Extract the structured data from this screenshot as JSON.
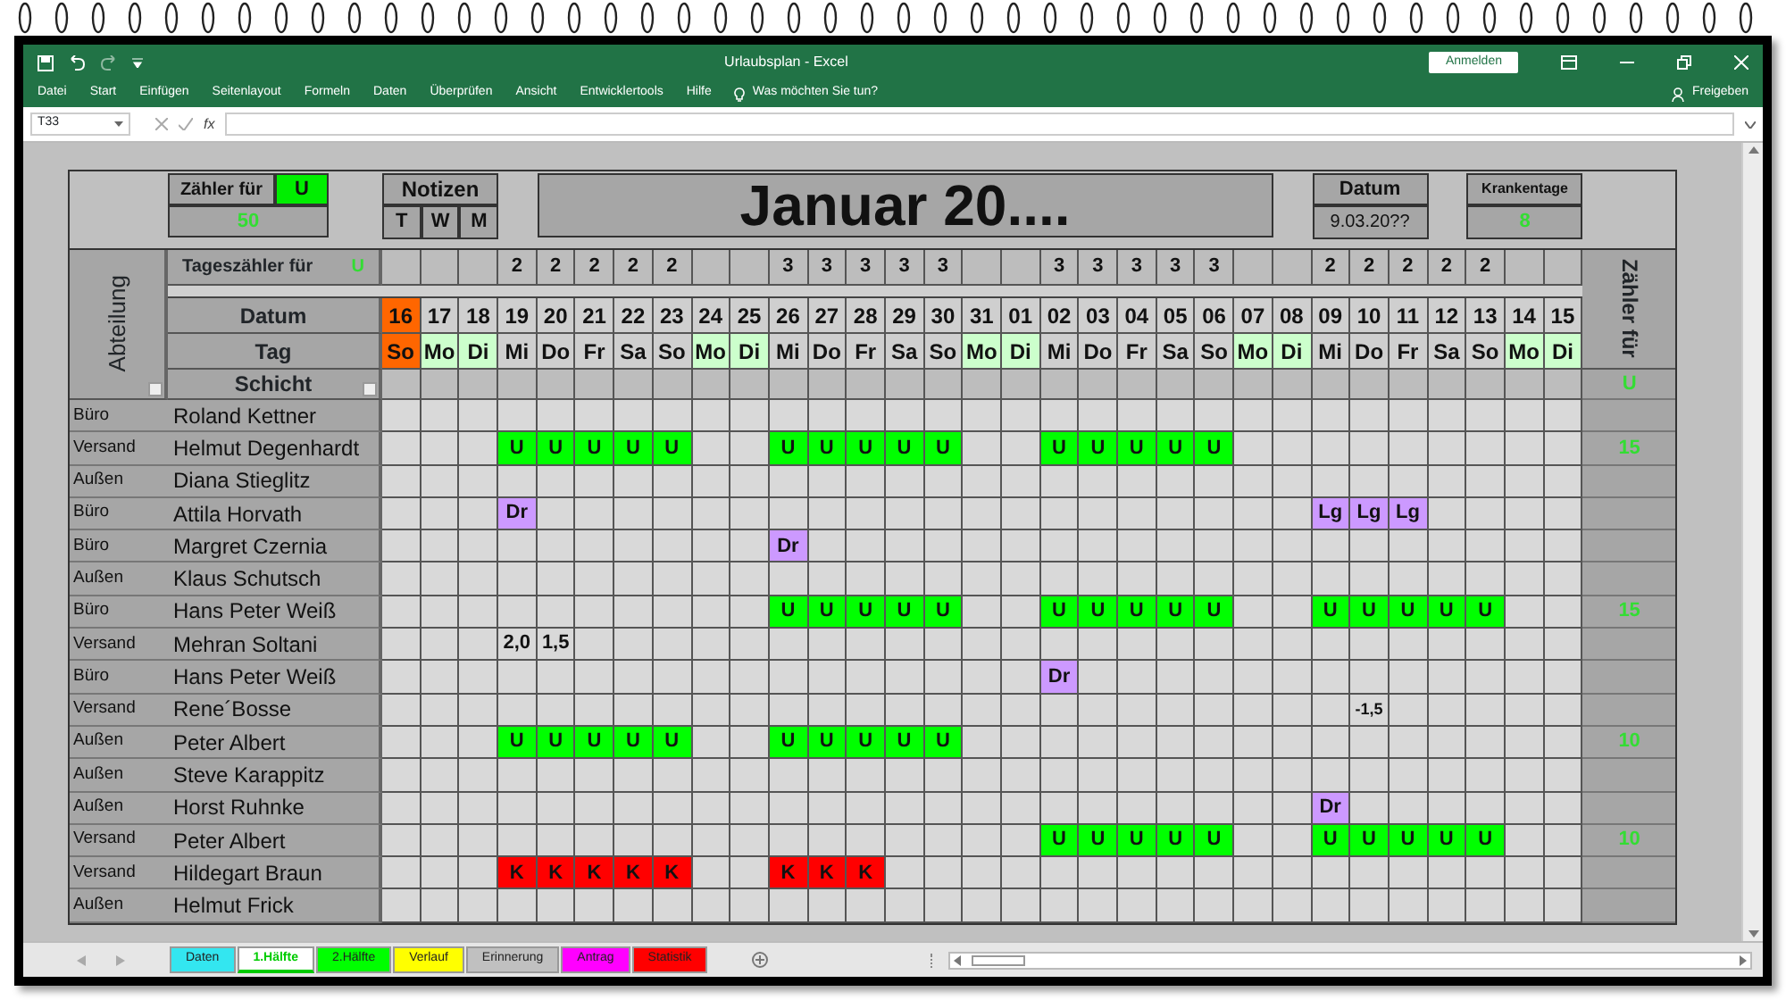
{
  "window": {
    "title": "Urlaubsplan  -  Excel",
    "sign_in": "Anmelden"
  },
  "ribbon": {
    "tabs": [
      "Datei",
      "Start",
      "Einfügen",
      "Seitenlayout",
      "Formeln",
      "Daten",
      "Überprüfen",
      "Ansicht",
      "Entwicklertools",
      "Hilfe"
    ],
    "tell_me": "Was möchten Sie tun?",
    "share": "Freigeben"
  },
  "formula_bar": {
    "name_box": "T33",
    "function_label": "fx"
  },
  "sheet": {
    "counter": {
      "label": "Zähler für",
      "code": "U",
      "value": "50"
    },
    "notes": {
      "title": "Notizen",
      "columns": [
        "T",
        "W",
        "M"
      ]
    },
    "title": "Januar 20....",
    "date": {
      "label": "Datum",
      "value": "9.03.20??"
    },
    "sick_days": {
      "label": "Krankentage",
      "value": "8"
    },
    "department_header": "Abteilung",
    "daily_counter": {
      "label": "Tageszähler für",
      "code": "U"
    },
    "row_labels": {
      "date": "Datum",
      "day": "Tag",
      "shift": "Schicht"
    },
    "total_header": {
      "label": "Zähler für",
      "code": "U"
    },
    "days": [
      {
        "date": "16",
        "day": "So",
        "current": true,
        "color": "#ff6600"
      },
      {
        "date": "17",
        "day": "Mo",
        "current": false,
        "color": "#ccffcc"
      },
      {
        "date": "18",
        "day": "Di",
        "current": false,
        "color": "#ccffcc"
      },
      {
        "date": "19",
        "day": "Mi",
        "current": false,
        "count": "2"
      },
      {
        "date": "20",
        "day": "Do",
        "current": false,
        "count": "2"
      },
      {
        "date": "21",
        "day": "Fr",
        "current": false,
        "count": "2"
      },
      {
        "date": "22",
        "day": "Sa",
        "current": false,
        "count": "2"
      },
      {
        "date": "23",
        "day": "So",
        "current": false,
        "count": "2"
      },
      {
        "date": "24",
        "day": "Mo",
        "current": false,
        "color": "#ccffcc"
      },
      {
        "date": "25",
        "day": "Di",
        "current": false,
        "color": "#ccffcc"
      },
      {
        "date": "26",
        "day": "Mi",
        "current": false,
        "count": "3"
      },
      {
        "date": "27",
        "day": "Do",
        "current": false,
        "count": "3"
      },
      {
        "date": "28",
        "day": "Fr",
        "current": false,
        "count": "3"
      },
      {
        "date": "29",
        "day": "Sa",
        "current": false,
        "count": "3"
      },
      {
        "date": "30",
        "day": "So",
        "current": false,
        "count": "3"
      },
      {
        "date": "31",
        "day": "Mo",
        "current": false,
        "color": "#ccffcc"
      },
      {
        "date": "01",
        "day": "Di",
        "current": false,
        "color": "#ccffcc"
      },
      {
        "date": "02",
        "day": "Mi",
        "current": false,
        "count": "3"
      },
      {
        "date": "03",
        "day": "Do",
        "current": false,
        "count": "3"
      },
      {
        "date": "04",
        "day": "Fr",
        "current": false,
        "count": "3"
      },
      {
        "date": "05",
        "day": "Sa",
        "current": false,
        "count": "3"
      },
      {
        "date": "06",
        "day": "So",
        "current": false,
        "count": "3"
      },
      {
        "date": "07",
        "day": "Mo",
        "current": false,
        "color": "#ccffcc"
      },
      {
        "date": "08",
        "day": "Di",
        "current": false,
        "color": "#ccffcc"
      },
      {
        "date": "09",
        "day": "Mi",
        "current": false,
        "count": "2"
      },
      {
        "date": "10",
        "day": "Do",
        "current": false,
        "count": "2"
      },
      {
        "date": "11",
        "day": "Fr",
        "current": false,
        "count": "2"
      },
      {
        "date": "12",
        "day": "Sa",
        "current": false,
        "count": "2"
      },
      {
        "date": "13",
        "day": "So",
        "current": false,
        "count": "2"
      },
      {
        "date": "14",
        "day": "Mo",
        "current": false,
        "color": "#ccffcc"
      },
      {
        "date": "15",
        "day": "Di",
        "current": false,
        "color": "#ccffcc"
      }
    ],
    "employees": [
      {
        "department": "Büro",
        "name": "Roland Kettner"
      },
      {
        "department": "Versand",
        "name": "Helmut Degenhardt",
        "total": "15",
        "cells": [
          null,
          null,
          null,
          {
            "text": "U",
            "color": "#00ff00"
          },
          {
            "text": "U",
            "color": "#00ff00"
          },
          {
            "text": "U",
            "color": "#00ff00"
          },
          {
            "text": "U",
            "color": "#00ff00"
          },
          {
            "text": "U",
            "color": "#00ff00"
          },
          null,
          null,
          {
            "text": "U",
            "color": "#00ff00"
          },
          {
            "text": "U",
            "color": "#00ff00"
          },
          {
            "text": "U",
            "color": "#00ff00"
          },
          {
            "text": "U",
            "color": "#00ff00"
          },
          {
            "text": "U",
            "color": "#00ff00"
          },
          null,
          null,
          {
            "text": "U",
            "color": "#00ff00"
          },
          {
            "text": "U",
            "color": "#00ff00"
          },
          {
            "text": "U",
            "color": "#00ff00"
          },
          {
            "text": "U",
            "color": "#00ff00"
          },
          {
            "text": "U",
            "color": "#00ff00"
          },
          null,
          null,
          null,
          null,
          null,
          null,
          null,
          null,
          null
        ]
      },
      {
        "department": "Außen",
        "name": "Diana Stieglitz"
      },
      {
        "department": "Büro",
        "name": "Attila Horvath",
        "cells": [
          null,
          null,
          null,
          {
            "text": "Dr",
            "color": "#cc99ff"
          },
          null,
          null,
          null,
          null,
          null,
          null,
          null,
          null,
          null,
          null,
          null,
          null,
          null,
          null,
          null,
          null,
          null,
          null,
          null,
          null,
          {
            "text": "Lg",
            "color": "#cc99ff"
          },
          {
            "text": "Lg",
            "color": "#cc99ff"
          },
          {
            "text": "Lg",
            "color": "#cc99ff"
          },
          null,
          null,
          null,
          null
        ]
      },
      {
        "department": "Büro",
        "name": "Margret Czernia",
        "cells": [
          null,
          null,
          null,
          null,
          null,
          null,
          null,
          null,
          null,
          null,
          {
            "text": "Dr",
            "color": "#cc99ff"
          },
          null,
          null,
          null,
          null,
          null,
          null,
          null,
          null,
          null,
          null,
          null,
          null,
          null,
          null,
          null,
          null,
          null,
          null,
          null,
          null
        ]
      },
      {
        "department": "Außen",
        "name": "Klaus Schutsch"
      },
      {
        "department": "Büro",
        "name": "Hans Peter Weiß",
        "total": "15",
        "cells": [
          null,
          null,
          null,
          null,
          null,
          null,
          null,
          null,
          null,
          null,
          {
            "text": "U",
            "color": "#00ff00"
          },
          {
            "text": "U",
            "color": "#00ff00"
          },
          {
            "text": "U",
            "color": "#00ff00"
          },
          {
            "text": "U",
            "color": "#00ff00"
          },
          {
            "text": "U",
            "color": "#00ff00"
          },
          null,
          null,
          {
            "text": "U",
            "color": "#00ff00"
          },
          {
            "text": "U",
            "color": "#00ff00"
          },
          {
            "text": "U",
            "color": "#00ff00"
          },
          {
            "text": "U",
            "color": "#00ff00"
          },
          {
            "text": "U",
            "color": "#00ff00"
          },
          null,
          null,
          {
            "text": "U",
            "color": "#00ff00"
          },
          {
            "text": "U",
            "color": "#00ff00"
          },
          {
            "text": "U",
            "color": "#00ff00"
          },
          {
            "text": "U",
            "color": "#00ff00"
          },
          {
            "text": "U",
            "color": "#00ff00"
          },
          null,
          null
        ]
      },
      {
        "department": "Versand",
        "name": "Mehran Soltani",
        "cells": [
          null,
          null,
          null,
          {
            "text": "2,0"
          },
          {
            "text": "1,5"
          },
          null,
          null,
          null,
          null,
          null,
          null,
          null,
          null,
          null,
          null,
          null,
          null,
          null,
          null,
          null,
          null,
          null,
          null,
          null,
          null,
          null,
          null,
          null,
          null,
          null,
          null
        ]
      },
      {
        "department": "Büro",
        "name": "Hans Peter Weiß",
        "cells": [
          null,
          null,
          null,
          null,
          null,
          null,
          null,
          null,
          null,
          null,
          null,
          null,
          null,
          null,
          null,
          null,
          null,
          {
            "text": "Dr",
            "color": "#cc99ff"
          },
          null,
          null,
          null,
          null,
          null,
          null,
          null,
          null,
          null,
          null,
          null,
          null,
          null
        ]
      },
      {
        "department": "Versand",
        "name": "Rene´Bosse",
        "cells": [
          null,
          null,
          null,
          null,
          null,
          null,
          null,
          null,
          null,
          null,
          null,
          null,
          null,
          null,
          null,
          null,
          null,
          null,
          null,
          null,
          null,
          null,
          null,
          null,
          null,
          {
            "text": "-1,5"
          },
          null,
          null,
          null,
          null,
          null
        ]
      },
      {
        "department": "Außen",
        "name": "Peter Albert",
        "total": "10",
        "cells": [
          null,
          null,
          null,
          {
            "text": "U",
            "color": "#00ff00"
          },
          {
            "text": "U",
            "color": "#00ff00"
          },
          {
            "text": "U",
            "color": "#00ff00"
          },
          {
            "text": "U",
            "color": "#00ff00"
          },
          {
            "text": "U",
            "color": "#00ff00"
          },
          null,
          null,
          {
            "text": "U",
            "color": "#00ff00"
          },
          {
            "text": "U",
            "color": "#00ff00"
          },
          {
            "text": "U",
            "color": "#00ff00"
          },
          {
            "text": "U",
            "color": "#00ff00"
          },
          {
            "text": "U",
            "color": "#00ff00"
          },
          null,
          null,
          null,
          null,
          null,
          null,
          null,
          null,
          null,
          null,
          null,
          null,
          null,
          null,
          null,
          null
        ]
      },
      {
        "department": "Außen",
        "name": "Steve Karappitz"
      },
      {
        "department": "Außen",
        "name": "Horst Ruhnke",
        "cells": [
          null,
          null,
          null,
          null,
          null,
          null,
          null,
          null,
          null,
          null,
          null,
          null,
          null,
          null,
          null,
          null,
          null,
          null,
          null,
          null,
          null,
          null,
          null,
          null,
          {
            "text": "Dr",
            "color": "#cc99ff"
          },
          null,
          null,
          null,
          null,
          null,
          null
        ]
      },
      {
        "department": "Versand",
        "name": "Peter Albert",
        "total": "10",
        "cells": [
          null,
          null,
          null,
          null,
          null,
          null,
          null,
          null,
          null,
          null,
          null,
          null,
          null,
          null,
          null,
          null,
          null,
          {
            "text": "U",
            "color": "#00ff00"
          },
          {
            "text": "U",
            "color": "#00ff00"
          },
          {
            "text": "U",
            "color": "#00ff00"
          },
          {
            "text": "U",
            "color": "#00ff00"
          },
          {
            "text": "U",
            "color": "#00ff00"
          },
          null,
          null,
          {
            "text": "U",
            "color": "#00ff00"
          },
          {
            "text": "U",
            "color": "#00ff00"
          },
          {
            "text": "U",
            "color": "#00ff00"
          },
          {
            "text": "U",
            "color": "#00ff00"
          },
          {
            "text": "U",
            "color": "#00ff00"
          },
          null,
          null
        ]
      },
      {
        "department": "Versand",
        "name": "Hildegart Braun",
        "cells": [
          null,
          null,
          null,
          {
            "text": "K",
            "color": "#ff0000"
          },
          {
            "text": "K",
            "color": "#ff0000"
          },
          {
            "text": "K",
            "color": "#ff0000"
          },
          {
            "text": "K",
            "color": "#ff0000"
          },
          {
            "text": "K",
            "color": "#ff0000"
          },
          null,
          null,
          {
            "text": "K",
            "color": "#ff0000"
          },
          {
            "text": "K",
            "color": "#ff0000"
          },
          {
            "text": "K",
            "color": "#ff0000"
          },
          null,
          null,
          null,
          null,
          null,
          null,
          null,
          null,
          null,
          null,
          null,
          null,
          null,
          null,
          null,
          null,
          null,
          null
        ]
      },
      {
        "department": "Außen",
        "name": "Helmut Frick"
      }
    ]
  },
  "sheet_tabs": [
    {
      "label": "Daten",
      "color": "#33e6f0",
      "selected": false
    },
    {
      "label": "1.Hälfte",
      "color": "#00cc00",
      "selected": true
    },
    {
      "label": "2.Hälfte",
      "color": "#00ff00",
      "selected": false
    },
    {
      "label": "Verlauf",
      "color": "#ffff00",
      "selected": false
    },
    {
      "label": "Erinnerung",
      "color": "#c0c0c0",
      "selected": false
    },
    {
      "label": "Antrag",
      "color": "#ff00ff",
      "selected": false
    },
    {
      "label": "Statistik",
      "color": "#ff0000",
      "selected": false
    }
  ]
}
